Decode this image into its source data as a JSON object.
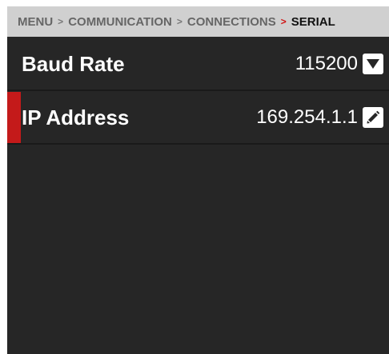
{
  "breadcrumb": {
    "items": [
      "MENU",
      "COMMUNICATION",
      "CONNECTIONS"
    ],
    "separator": ">",
    "current": "SERIAL"
  },
  "settings": [
    {
      "label": "Baud Rate",
      "value": "115200",
      "control_icon": "dropdown-arrow-icon"
    },
    {
      "label": "IP Address",
      "value": "169.254.1.1",
      "control_icon": "pencil-edit-icon"
    }
  ],
  "colors": {
    "background": "#262626",
    "breadcrumb_bar": "#d0d0d0",
    "accent": "#c41a1a",
    "text": "#ffffff"
  }
}
